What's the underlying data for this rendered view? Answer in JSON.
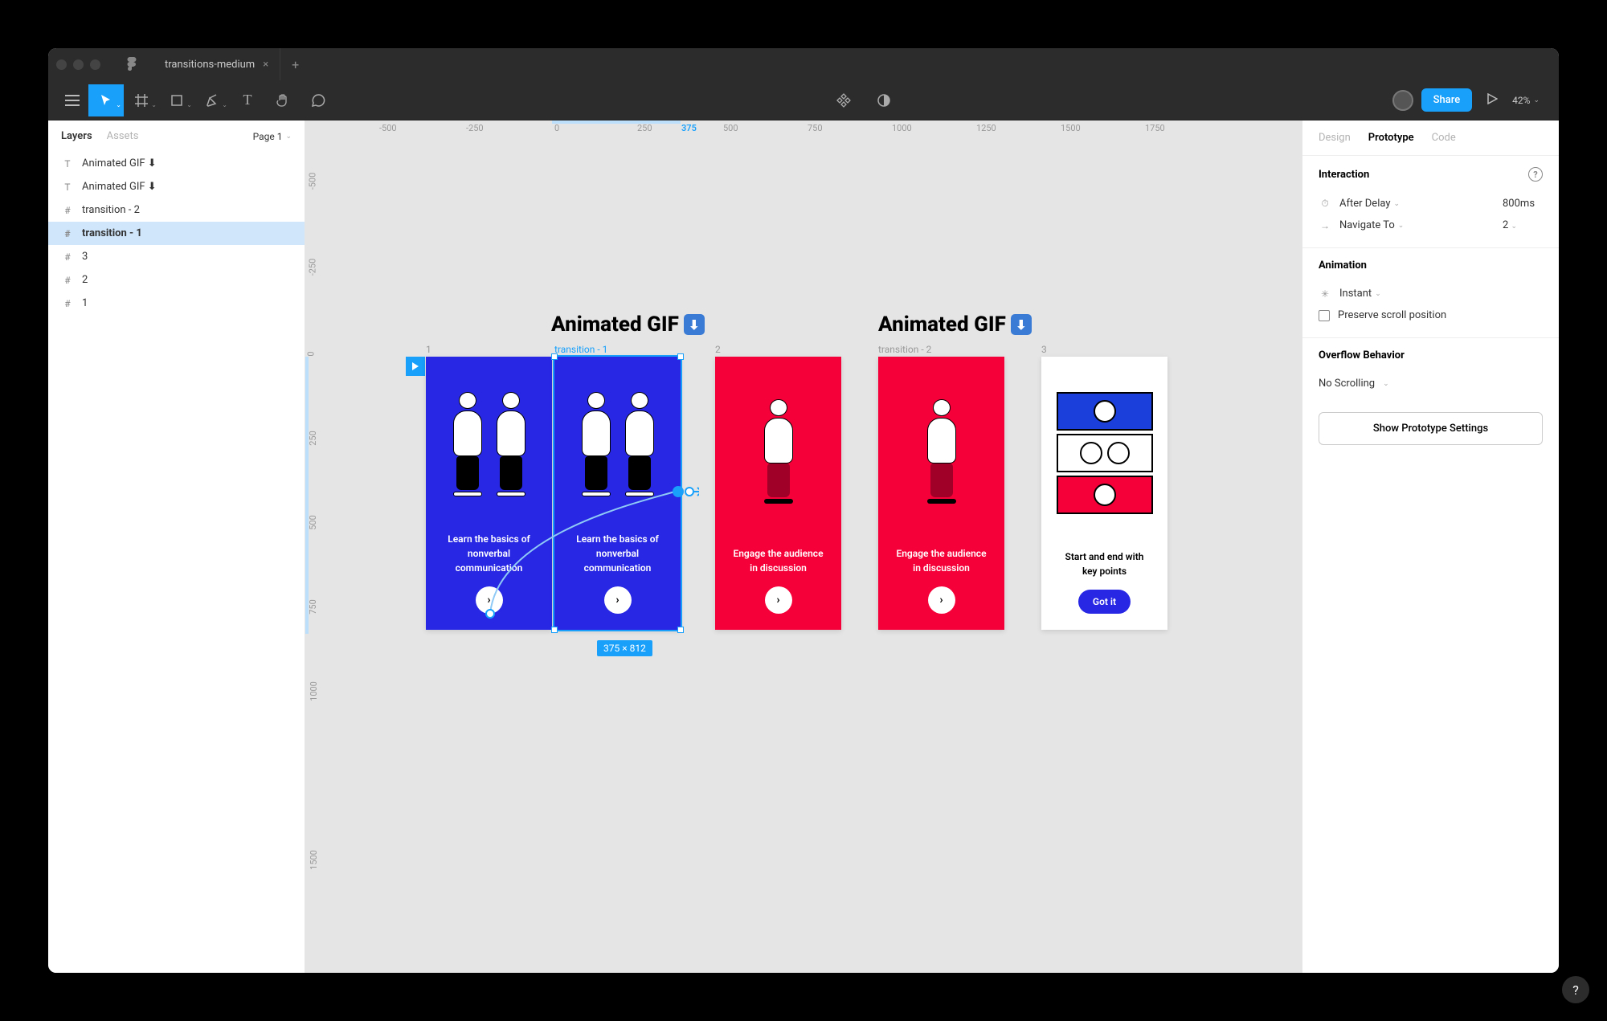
{
  "titlebar": {
    "filename": "transitions-medium"
  },
  "toolbar": {
    "share": "Share",
    "zoom": "42%"
  },
  "leftPanel": {
    "tabs": {
      "layers": "Layers",
      "assets": "Assets"
    },
    "page": "Page 1",
    "items": [
      {
        "icon": "T",
        "label": "Animated GIF ⬇"
      },
      {
        "icon": "T",
        "label": "Animated GIF ⬇"
      },
      {
        "icon": "#",
        "label": "transition - 2"
      },
      {
        "icon": "#",
        "label": "transition - 1",
        "selected": true
      },
      {
        "icon": "#",
        "label": "3"
      },
      {
        "icon": "#",
        "label": "2"
      },
      {
        "icon": "#",
        "label": "1"
      }
    ]
  },
  "rulerH": [
    "-500",
    "-250",
    "0",
    "250",
    "375",
    "500",
    "750",
    "1000",
    "1250",
    "1500",
    "1750"
  ],
  "rulerV": [
    "-500",
    "-250",
    "0",
    "250",
    "500",
    "750",
    "1000",
    "1500"
  ],
  "headings": {
    "h1": "Animated GIF",
    "h2": "Animated GIF"
  },
  "frames": {
    "f1": {
      "label": "1",
      "line1": "Learn the basics of",
      "line2": "nonverbal communication"
    },
    "ft1": {
      "label": "transition - 1",
      "line1": "Learn the basics of",
      "line2": "nonverbal communication"
    },
    "f2": {
      "label": "2",
      "line1": "Engage the audience",
      "line2": "in discussion"
    },
    "ft2": {
      "label": "transition - 2",
      "line1": "Engage the audience",
      "line2": "in discussion"
    },
    "f3": {
      "label": "3",
      "line1": "Start and end with",
      "line2": "key points",
      "button": "Got it"
    }
  },
  "selection": {
    "dims": "375 × 812"
  },
  "rightPanel": {
    "tabs": {
      "design": "Design",
      "prototype": "Prototype",
      "code": "Code"
    },
    "interaction": {
      "title": "Interaction",
      "trigger": "After Delay",
      "delay": "800ms",
      "action": "Navigate To",
      "target": "2"
    },
    "animation": {
      "title": "Animation",
      "type": "Instant",
      "preserve": "Preserve scroll position"
    },
    "overflow": {
      "title": "Overflow Behavior",
      "value": "No Scrolling"
    },
    "showSettings": "Show Prototype Settings"
  }
}
